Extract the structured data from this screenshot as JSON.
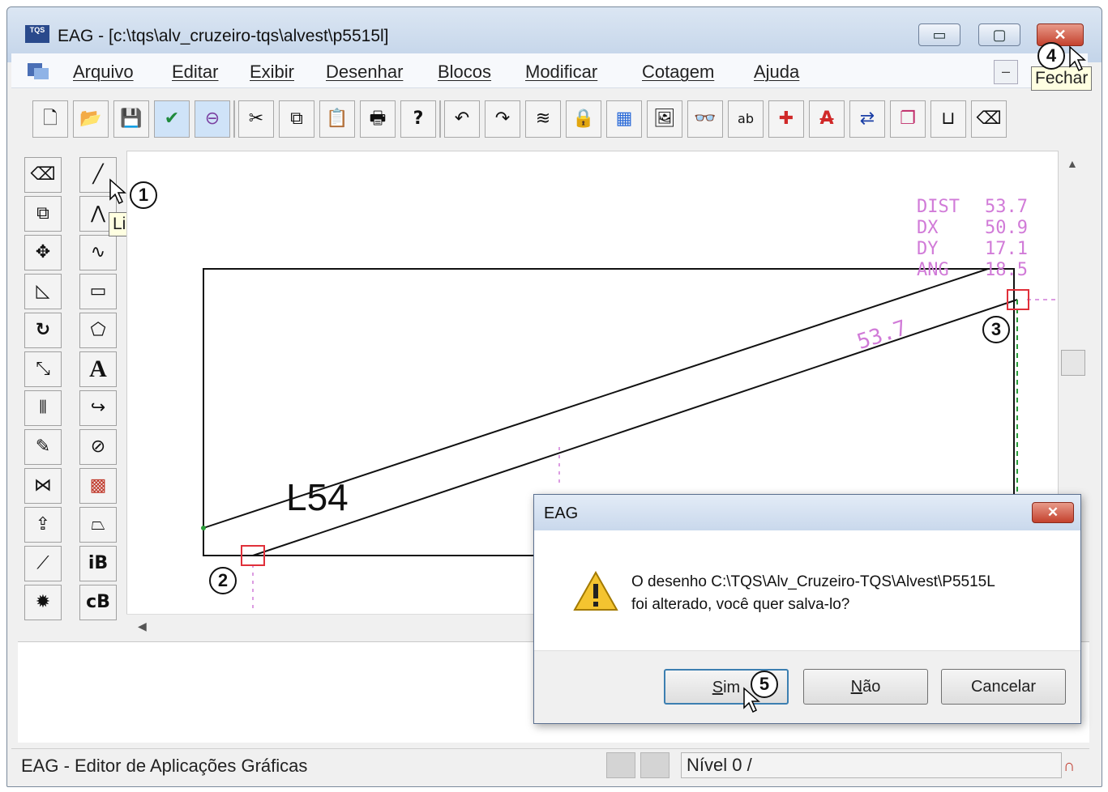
{
  "window": {
    "title": "EAG - [c:\\tqs\\alv_cruzeiro-tqs\\alvest\\p5515l]",
    "app_icon_text": "TQS",
    "minimize_icon": "minimize-icon",
    "maximize_icon": "maximize-icon",
    "close_icon": "close-icon"
  },
  "menu": {
    "items": [
      "Arquivo",
      "Editar",
      "Exibir",
      "Desenhar",
      "Blocos",
      "Modificar",
      "Cotagem",
      "Ajuda"
    ],
    "mdi_minimize": "–"
  },
  "tooltips": {
    "close": "Fechar",
    "line": "Linha"
  },
  "toolbar": {
    "buttons": [
      {
        "icon": "new-document-icon",
        "glyph": "🗋"
      },
      {
        "icon": "open-folder-icon",
        "glyph": "📂"
      },
      {
        "icon": "save-icon",
        "glyph": "💾"
      },
      {
        "icon": "check-icon",
        "glyph": "✔"
      },
      {
        "icon": "stop-icon",
        "glyph": "⊖"
      },
      {
        "icon": "cut-icon",
        "glyph": "✂"
      },
      {
        "icon": "copy-icon",
        "glyph": "⧉"
      },
      {
        "icon": "paste-icon",
        "glyph": "📋"
      },
      {
        "icon": "print-icon",
        "glyph": "🖶"
      },
      {
        "icon": "help-icon",
        "glyph": "?"
      },
      {
        "icon": "undo-icon",
        "glyph": "↶"
      },
      {
        "icon": "redo-icon",
        "glyph": "↷"
      },
      {
        "icon": "layers-icon",
        "glyph": "≋"
      },
      {
        "icon": "lock-icon",
        "glyph": "🔒"
      },
      {
        "icon": "color-palette-icon",
        "glyph": "▦"
      },
      {
        "icon": "image-icon",
        "glyph": "🖼"
      },
      {
        "icon": "find-icon",
        "glyph": "👓"
      },
      {
        "icon": "replace-text-icon",
        "glyph": "ab"
      },
      {
        "icon": "insert-point-icon",
        "glyph": "✚"
      },
      {
        "icon": "text-strike-icon",
        "glyph": "A"
      },
      {
        "icon": "swap-icon",
        "glyph": "⇄"
      },
      {
        "icon": "window-arrange-icon",
        "glyph": "❐"
      },
      {
        "icon": "dimension-icon",
        "glyph": "⊔"
      },
      {
        "icon": "eraser-icon",
        "glyph": "⌫"
      }
    ]
  },
  "left_tools": [
    {
      "icon": "eraser-icon",
      "glyph": "⌫"
    },
    {
      "icon": "copy-objects-icon",
      "glyph": "⧉"
    },
    {
      "icon": "move-icon",
      "glyph": "✥"
    },
    {
      "icon": "stretch-icon",
      "glyph": "◺"
    },
    {
      "icon": "rotate-icon",
      "glyph": "↻"
    },
    {
      "icon": "scale-icon",
      "glyph": "⤡"
    },
    {
      "icon": "mirror-icon",
      "glyph": "⫴"
    },
    {
      "icon": "trim-icon",
      "glyph": "✎"
    },
    {
      "icon": "fillet-icon",
      "glyph": "⋈"
    },
    {
      "icon": "array-icon",
      "glyph": "⇪"
    },
    {
      "icon": "extend-icon",
      "glyph": "⟋"
    },
    {
      "icon": "explode-icon",
      "glyph": "✹"
    }
  ],
  "draw_tools": [
    {
      "icon": "line-icon",
      "glyph": "╱"
    },
    {
      "icon": "polyline-icon",
      "glyph": "⋀"
    },
    {
      "icon": "spline-icon",
      "glyph": "∿"
    },
    {
      "icon": "rectangle-icon",
      "glyph": "▭"
    },
    {
      "icon": "polygon-icon",
      "glyph": "⬠"
    },
    {
      "icon": "text-icon",
      "glyph": "A"
    },
    {
      "icon": "arc-icon",
      "glyph": "↪"
    },
    {
      "icon": "circle-icon",
      "glyph": "⊘"
    },
    {
      "icon": "hatch-icon",
      "glyph": "▩"
    },
    {
      "icon": "trapezoid-icon",
      "glyph": "⏢"
    },
    {
      "icon": "insert-block-icon",
      "glyph": "iB"
    },
    {
      "icon": "create-block-icon",
      "glyph": "cB"
    }
  ],
  "drawing": {
    "label": "L54",
    "dim_value": "53.7",
    "readout": [
      "DIST",
      "53.7",
      "DX",
      "50.9",
      "DY",
      "17.1",
      "ANG",
      "18.5"
    ]
  },
  "callouts": [
    "1",
    "2",
    "3",
    "4",
    "5"
  ],
  "dialog": {
    "title": "EAG",
    "message_line1": "O desenho C:\\TQS\\Alv_Cruzeiro-TQS\\Alvest\\P5515L",
    "message_line2": "foi alterado, você quer salva-lo?",
    "btn_yes_u": "S",
    "btn_yes_rest": "im",
    "btn_no_u": "N",
    "btn_no_rest": "ão",
    "btn_cancel": "Cancelar"
  },
  "status": {
    "app_name": "EAG - Editor de Aplicações Gráficas",
    "level": "Nível 0 /"
  },
  "colors": {
    "dialog_accent": "#3c7fb1",
    "readout_magenta": "#d17bd8",
    "marker_red": "#e0303a",
    "guide_green": "#2a9d3a",
    "close_red": "#c4412d"
  }
}
